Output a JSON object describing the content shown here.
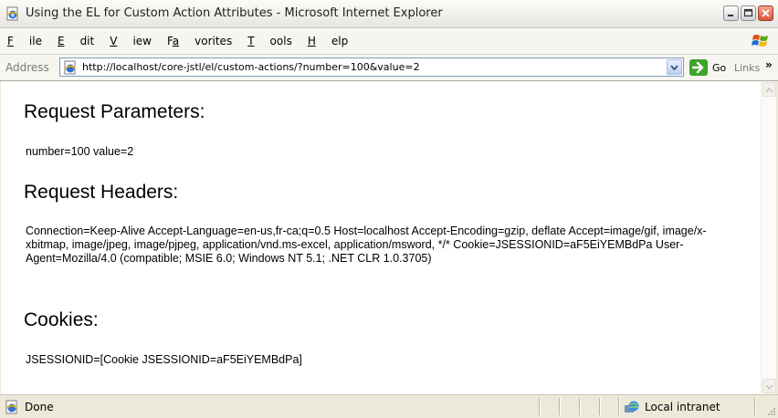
{
  "window": {
    "title": "Using the EL for Custom Action Attributes - Microsoft Internet Explorer"
  },
  "menu": [
    {
      "label": "File",
      "ul": "F",
      "rest": "ile"
    },
    {
      "label": "Edit",
      "ul": "E",
      "rest": "dit"
    },
    {
      "label": "View",
      "ul": "V",
      "rest": "iew"
    },
    {
      "label": "Favorites",
      "pre": "F",
      "ul": "a",
      "rest": "vorites"
    },
    {
      "label": "Tools",
      "ul": "T",
      "rest": "ools"
    },
    {
      "label": "Help",
      "ul": "H",
      "rest": "elp"
    }
  ],
  "address": {
    "label": "Address",
    "url": "http://localhost/core-jstl/el/custom-actions/?number=100&value=2",
    "go_label": "Go",
    "links_label": "Links"
  },
  "content": {
    "params_heading": "Request Parameters:",
    "params_text": "number=100 value=2",
    "headers_heading": "Request Headers:",
    "headers_text": "Connection=Keep-Alive Accept-Language=en-us,fr-ca;q=0.5 Host=localhost Accept-Encoding=gzip, deflate Accept=image/gif, image/x-xbitmap, image/jpeg, image/pjpeg, application/vnd.ms-excel, application/msword, */* Cookie=JSESSIONID=aF5EiYEMBdPa User-Agent=Mozilla/4.0 (compatible; MSIE 6.0; Windows NT 5.1; .NET CLR 1.0.3705)",
    "cookies_heading": "Cookies:",
    "cookies_text": "JSESSIONID=[Cookie JSESSIONID=aF5EiYEMBdPa]"
  },
  "status": {
    "text": "Done",
    "zone": "Local intranet"
  },
  "icons": {
    "title": "ie-page-icon",
    "minimize": "minimize-icon",
    "maximize": "maximize-icon",
    "close": "close-icon",
    "go": "go-arrow-icon",
    "zone": "intranet-globe-icon"
  }
}
